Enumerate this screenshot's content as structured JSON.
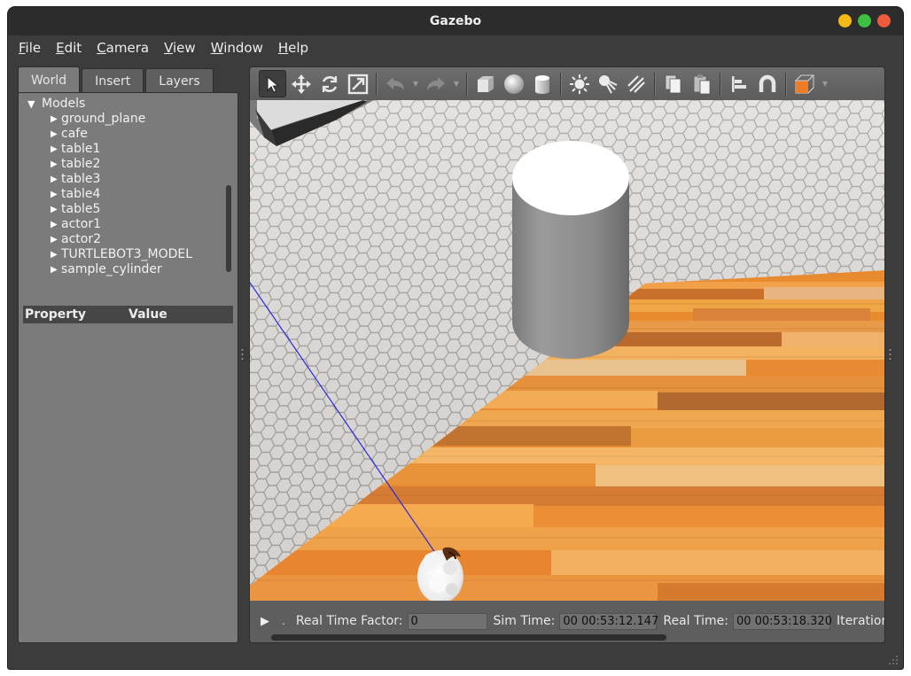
{
  "window": {
    "title": "Gazebo",
    "controls": [
      "minimize",
      "maximize",
      "close"
    ]
  },
  "menu": [
    "File",
    "Edit",
    "Camera",
    "View",
    "Window",
    "Help"
  ],
  "left_panel": {
    "tabs": [
      "World",
      "Insert",
      "Layers"
    ],
    "active_tab": "World",
    "tree": {
      "root": "Models",
      "children": [
        "ground_plane",
        "cafe",
        "table1",
        "table2",
        "table3",
        "table4",
        "table5",
        "actor1",
        "actor2",
        "TURTLEBOT3_MODEL",
        "sample_cylinder"
      ]
    },
    "property_header": {
      "property": "Property",
      "value": "Value"
    }
  },
  "toolbar": {
    "tools": [
      "select-arrow-icon",
      "translate-icon",
      "rotate-icon",
      "scale-icon",
      "undo-icon",
      "redo-icon",
      "box-icon",
      "sphere-icon",
      "cylinder-icon",
      "point-light-icon",
      "spot-light-icon",
      "directional-light-icon",
      "copy-icon",
      "paste-icon",
      "align-icon",
      "snap-icon",
      "view-angle-icon"
    ],
    "active_tool": "select-arrow-icon"
  },
  "status_bar": {
    "separator": ".",
    "real_time_factor_label": "Real Time Factor:",
    "real_time_factor": "0",
    "sim_time_label": "Sim Time:",
    "sim_time": "00 00:53:12.147",
    "real_time_label": "Real Time:",
    "real_time": "00 00:53:18.320",
    "iterations_label": "Iterations"
  },
  "colors": {
    "title_bar": "#2c2c2c",
    "minimize": "#f4b915",
    "maximize": "#3fbf3f",
    "close": "#ee5a3b",
    "accent_orange": "#ee7d2a",
    "ray_line": "#2a2adf"
  }
}
